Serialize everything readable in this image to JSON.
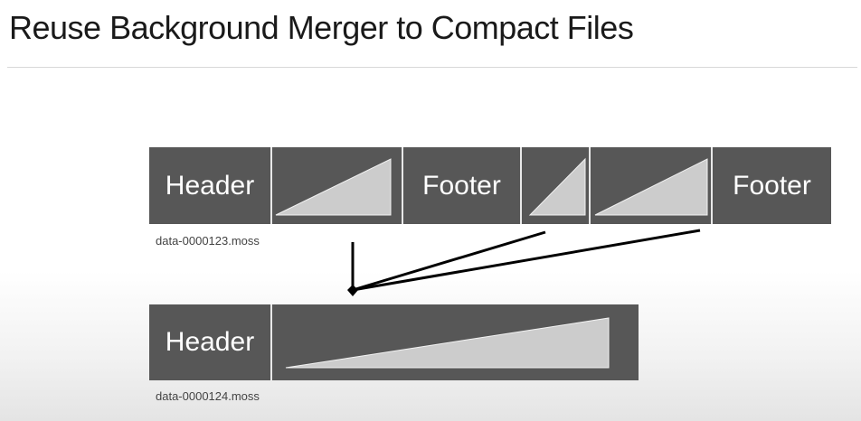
{
  "title": "Reuse Background Merger to Compact Files",
  "source_file": {
    "name": "data-0000123.moss",
    "segments": [
      {
        "kind": "header",
        "label": "Header"
      },
      {
        "kind": "data",
        "label": ""
      },
      {
        "kind": "footer",
        "label": "Footer"
      },
      {
        "kind": "data",
        "label": ""
      },
      {
        "kind": "data",
        "label": ""
      },
      {
        "kind": "footer",
        "label": "Footer"
      }
    ]
  },
  "merged_file": {
    "name": "data-0000124.moss",
    "segments": [
      {
        "kind": "header",
        "label": "Header"
      },
      {
        "kind": "data",
        "label": ""
      }
    ]
  },
  "colors": {
    "segment_fill": "#575757",
    "data_wedge": "#cccccc",
    "text": "#ffffff",
    "arrow": "#000000"
  }
}
